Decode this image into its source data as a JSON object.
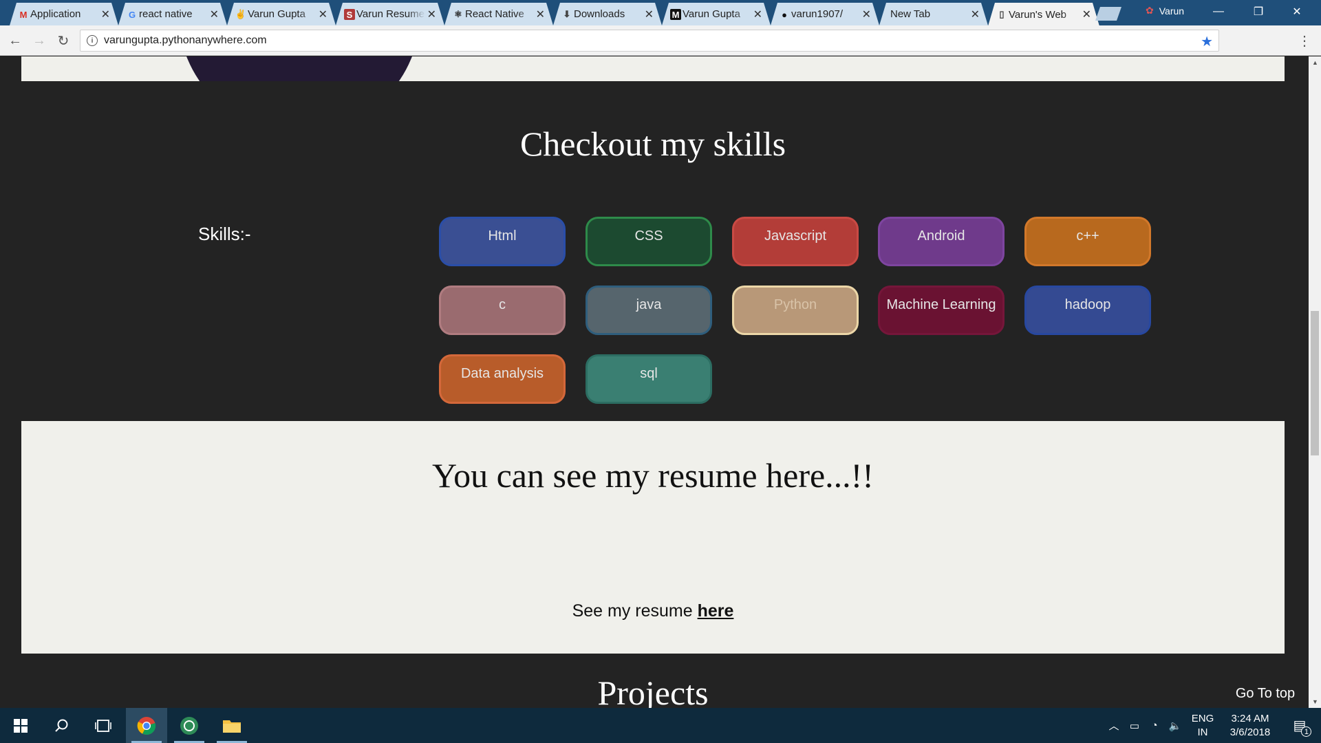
{
  "browser": {
    "tabs": [
      {
        "title": "Application",
        "icon": "gmail-icon",
        "glyph": "M",
        "glyph_color": "#d93025",
        "active": false
      },
      {
        "title": "react native",
        "icon": "google-icon",
        "glyph": "G",
        "glyph_color": "#4285f4",
        "active": false
      },
      {
        "title": "Varun Gupta",
        "icon": "angellist-icon",
        "glyph": "✌",
        "glyph_color": "#333333",
        "active": false
      },
      {
        "title": "Varun Resume",
        "icon": "s-icon",
        "glyph": "S",
        "glyph_color": "#ffffff",
        "glyph_bg": "#b03a3a",
        "active": false
      },
      {
        "title": "React Native",
        "icon": "react-icon",
        "glyph": "⚛",
        "glyph_color": "#222222",
        "active": false
      },
      {
        "title": "Downloads",
        "icon": "download-icon",
        "glyph": "⬇",
        "glyph_color": "#444444",
        "active": false
      },
      {
        "title": "Varun Gupta",
        "icon": "medium-icon",
        "glyph": "M",
        "glyph_color": "#ffffff",
        "glyph_bg": "#111111",
        "active": false
      },
      {
        "title": "varun1907/",
        "icon": "github-icon",
        "glyph": "●",
        "glyph_color": "#111111",
        "active": false
      },
      {
        "title": "New Tab",
        "icon": "",
        "glyph": "",
        "glyph_color": "#333333",
        "active": false
      },
      {
        "title": "Varun's Web",
        "icon": "page-icon",
        "glyph": "▯",
        "glyph_color": "#444444",
        "active": true
      }
    ],
    "profile_name": "Varun",
    "url": "varungupta.pythonanywhere.com"
  },
  "page": {
    "skills_heading": "Checkout my skills",
    "skills_label": "Skills:-",
    "skills": [
      {
        "name": "Html",
        "bg": "#3a4f93",
        "border": "#2a4ea8",
        "color": "#e6e6e6"
      },
      {
        "name": "CSS",
        "bg": "#1c4a30",
        "border": "#2e8b4a",
        "color": "#e6e6e6"
      },
      {
        "name": "Javascript",
        "bg": "#b33d38",
        "border": "#c94a44",
        "color": "#e6e6e6"
      },
      {
        "name": "Android",
        "bg": "#6f3a8b",
        "border": "#7e45a0",
        "color": "#e6e6e6"
      },
      {
        "name": "c++",
        "bg": "#b8691e",
        "border": "#d2782a",
        "color": "#e6e6e6"
      },
      {
        "name": "c",
        "bg": "#9a6b6f",
        "border": "#b07c80",
        "color": "#e6e6e6"
      },
      {
        "name": "java",
        "bg": "#56656d",
        "border": "#2f5e7d",
        "color": "#e6e6e6"
      },
      {
        "name": "Python",
        "bg": "#b89878",
        "border": "#ecd7a8",
        "color": "#d9c3a8"
      },
      {
        "name": "Machine Learning",
        "bg": "#6a1232",
        "border": "#75163a",
        "color": "#e6e6e6"
      },
      {
        "name": "hadoop",
        "bg": "#344a92",
        "border": "#2848a0",
        "color": "#e6e6e6"
      },
      {
        "name": "Data analysis",
        "bg": "#b85c2a",
        "border": "#d4683a",
        "color": "#e6e6e6"
      },
      {
        "name": "sql",
        "bg": "#3a7f72",
        "border": "#2c6d62",
        "color": "#e6e6e6"
      }
    ],
    "resume_heading": "You can see my resume here...!!",
    "resume_text": "See my resume ",
    "resume_link": "here",
    "projects_heading": "Projects",
    "go_top": "Go To top"
  },
  "taskbar": {
    "language": "ENG",
    "region": "IN",
    "time": "3:24 AM",
    "date": "3/6/2018",
    "notification_count": "1"
  }
}
